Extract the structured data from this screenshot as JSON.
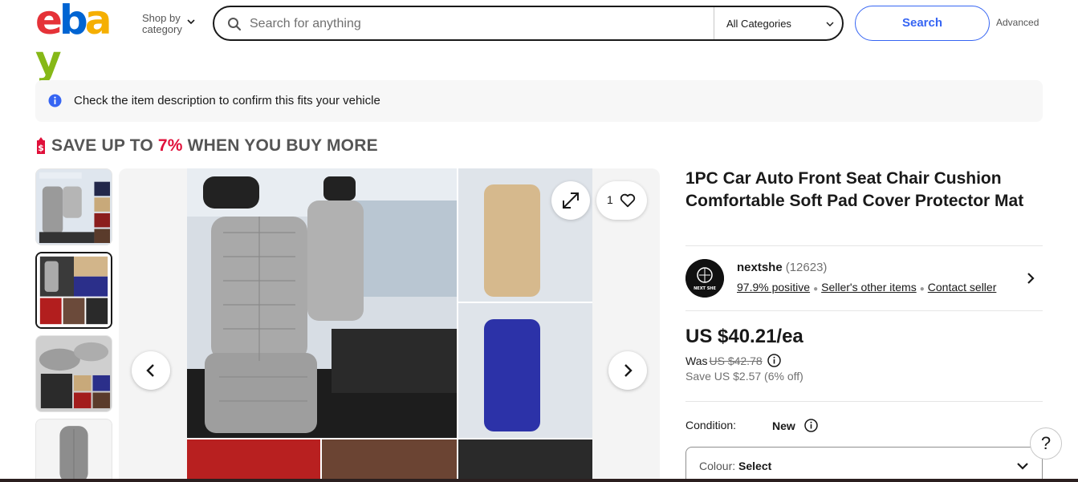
{
  "header": {
    "logo_letters": [
      "e",
      "b",
      "a",
      "y"
    ],
    "logo_colors": [
      "#e53238",
      "#0064d2",
      "#f5af02",
      "#86b817"
    ],
    "shop_by_line1": "Shop by",
    "shop_by_line2": "category",
    "search_placeholder": "Search for anything",
    "category_select": "All Categories",
    "search_button": "Search",
    "advanced_link": "Advanced"
  },
  "notice": {
    "text": "Check the item description to confirm this fits your vehicle",
    "icon": "info-icon"
  },
  "save_banner": {
    "prefix": "SAVE UP TO",
    "percent": "7%",
    "suffix": "WHEN YOU BUY MORE"
  },
  "gallery": {
    "thumbnail_count": 4,
    "active_thumbnail": 2,
    "watch_count": "1"
  },
  "item": {
    "title": "1PC Car Auto Front Seat Chair Cushion Comfortable Soft Pad Cover Protector Mat",
    "seller": {
      "name": "nextshe",
      "feedback_count": "(12623)",
      "positive": "97.9% positive",
      "other_items": "Seller's other items",
      "contact": "Contact seller",
      "logo_text": "NEXT SHE"
    },
    "price": "US $40.21/ea",
    "was_label": "Was",
    "was_price": "US $42.78",
    "save_line": "Save US $2.57 (6% off)",
    "condition_label": "Condition:",
    "condition_value": "New",
    "colour_label": "Colour:",
    "colour_value": "Select"
  },
  "help": "?",
  "colors": {
    "accent_blue": "#3665f3",
    "save_red": "#e0103a"
  }
}
